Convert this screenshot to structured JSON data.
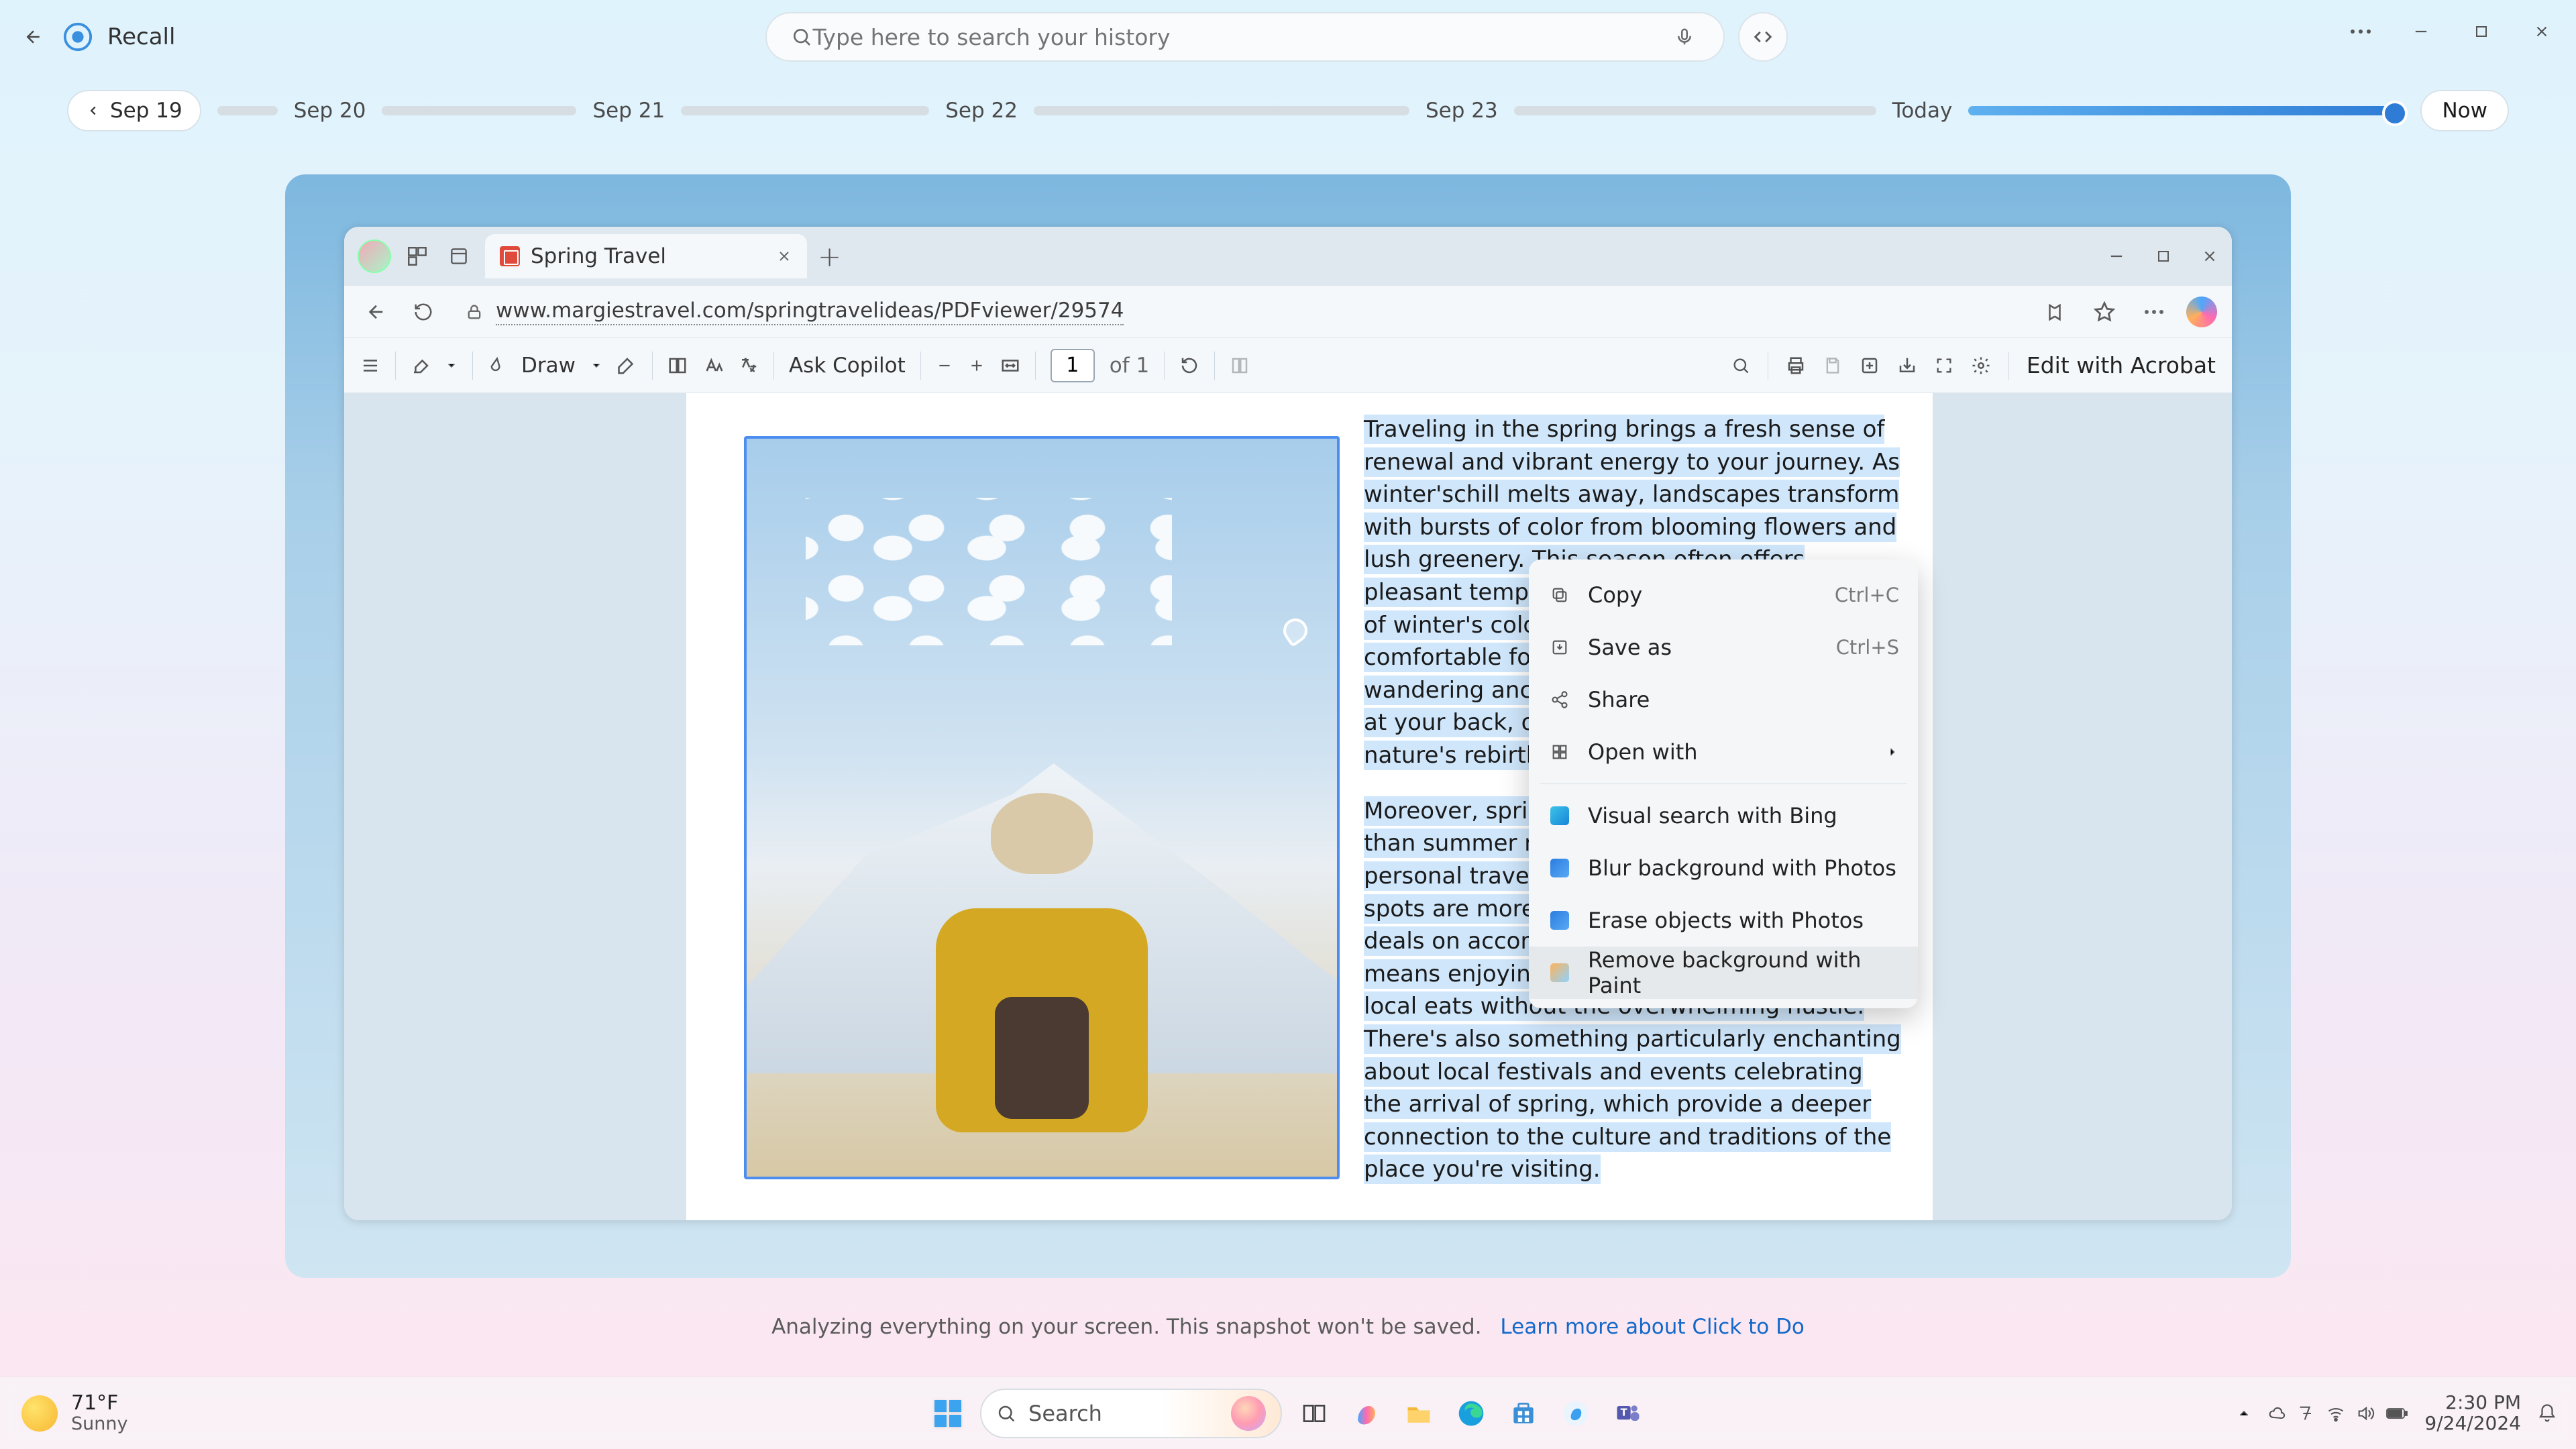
{
  "recall": {
    "title": "Recall",
    "search_placeholder": "Type here to search your history"
  },
  "timeline": {
    "start_chip": "Sep 19",
    "dates": [
      "Sep 20",
      "Sep 21",
      "Sep 22",
      "Sep 23"
    ],
    "today": "Today",
    "now": "Now"
  },
  "tab": {
    "title": "Spring Travel"
  },
  "url": "www.margiestravel.com/springtravelideas/PDFviewer/29574",
  "pdftb": {
    "draw": "Draw",
    "ask": "Ask Copilot",
    "page_current": "1",
    "page_total": "of 1",
    "edit": "Edit with Acrobat"
  },
  "doc": {
    "p1": "Traveling in the spring brings a fresh sense of renewal and vibrant energy to your journey. As winter'schill melts away, landscapes transform with bursts of color from blooming flowers and lush greenery. This season often offers pleasant temperatures, avoiding the extremes of winter's cold and summer's heat, making it comfortable for outdoor explorations. Imagine wandering ancient streets with a gentle breeze at your back, or hiking trails surrounded by nature's rebirth.",
    "p2": "Moreover, spring tends to be less crowded than summer months, allowing for a more personal travel experience. Popular tourist spots are more accessible, and you might find deals on accommodations and flights. This means enjoying attractions, museums, and local eats without the overwhelming hustle. There's also something particularly enchanting about local festivals and events celebrating the arrival of spring, which provide a deeper connection to the culture and traditions of the place you're visiting."
  },
  "ctx": {
    "copy": "Copy",
    "copy_k": "Ctrl+C",
    "save": "Save as",
    "save_k": "Ctrl+S",
    "share": "Share",
    "open": "Open with",
    "bing": "Visual search with Bing",
    "blur": "Blur background with Photos",
    "erase": "Erase objects with Photos",
    "removebg": "Remove background with Paint"
  },
  "footer": {
    "msg": "Analyzing everything on your screen. This snapshot won't be saved.",
    "link": "Learn more about Click to Do"
  },
  "taskbar": {
    "temp": "71°F",
    "cond": "Sunny",
    "search": "Search",
    "time": "2:30 PM",
    "date": "9/24/2024"
  }
}
